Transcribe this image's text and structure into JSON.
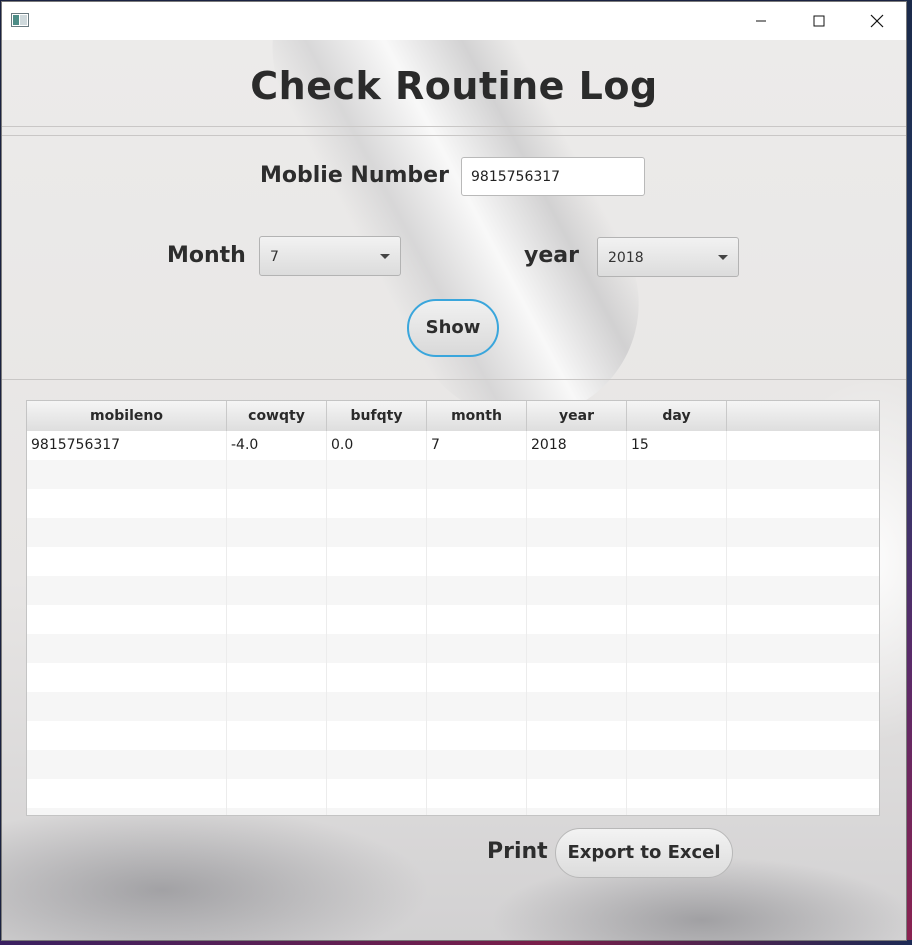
{
  "window": {
    "controls": {
      "minimize": "minimize-icon",
      "maximize": "maximize-icon",
      "close": "close-icon"
    }
  },
  "page": {
    "title": "Check Routine Log"
  },
  "form": {
    "mobile_label": "Moblie Number",
    "mobile_value": "9815756317",
    "month_label": "Month",
    "month_value": "7",
    "year_label": "year",
    "year_value": "2018",
    "show_label": "Show"
  },
  "table": {
    "columns": [
      "mobileno",
      "cowqty",
      "bufqty",
      "month",
      "year",
      "day",
      ""
    ],
    "rows": [
      [
        "9815756317",
        "-4.0",
        "0.0",
        "7",
        "2018",
        "15",
        ""
      ]
    ]
  },
  "footer": {
    "print_label": "Print",
    "export_label": "Export to Excel"
  },
  "colors": {
    "focus_border": "#3aa6dc",
    "title_text": "#2b2b2b"
  }
}
